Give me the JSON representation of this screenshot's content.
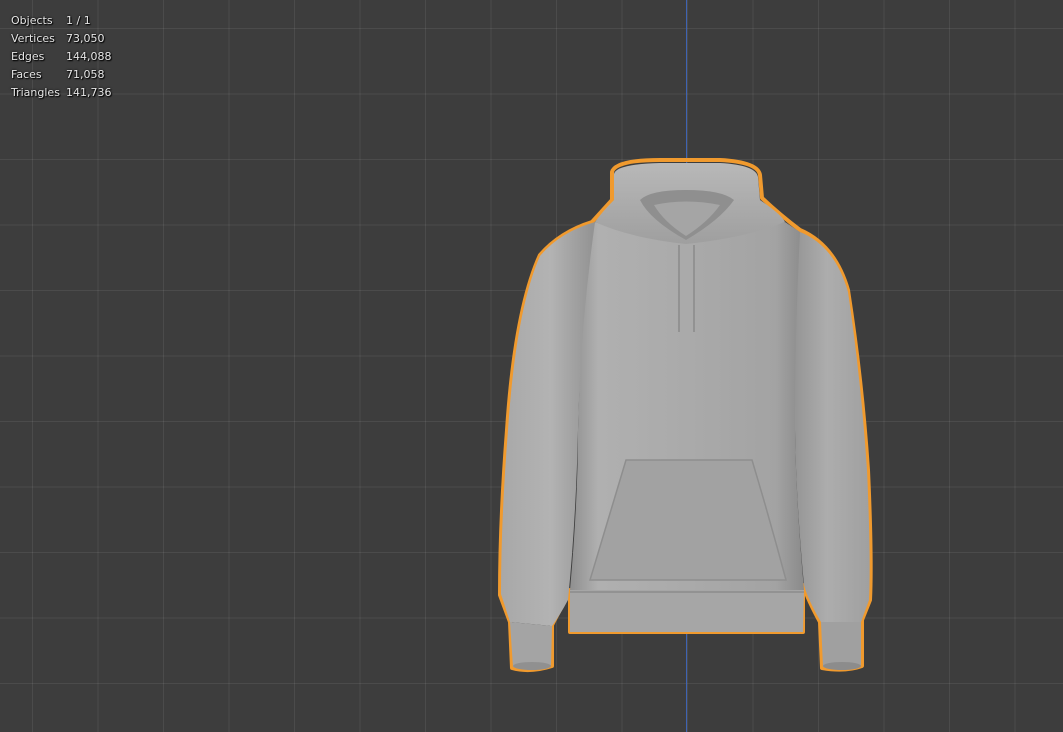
{
  "viewport": {
    "name": "3D Viewport",
    "colors": {
      "background": "#3d3d3d",
      "grid": "#4a4a4a",
      "z_axis": "#3e63b3",
      "selection_outline": "#f09a2e",
      "mesh": "#a8a8a8"
    }
  },
  "statistics": {
    "rows": [
      {
        "label": "Objects",
        "value": "1 / 1"
      },
      {
        "label": "Vertices",
        "value": "73,050"
      },
      {
        "label": "Edges",
        "value": "144,088"
      },
      {
        "label": "Faces",
        "value": "71,058"
      },
      {
        "label": "Triangles",
        "value": "141,736"
      }
    ]
  },
  "object": {
    "icon": "hoodie-mesh",
    "selected": true
  }
}
